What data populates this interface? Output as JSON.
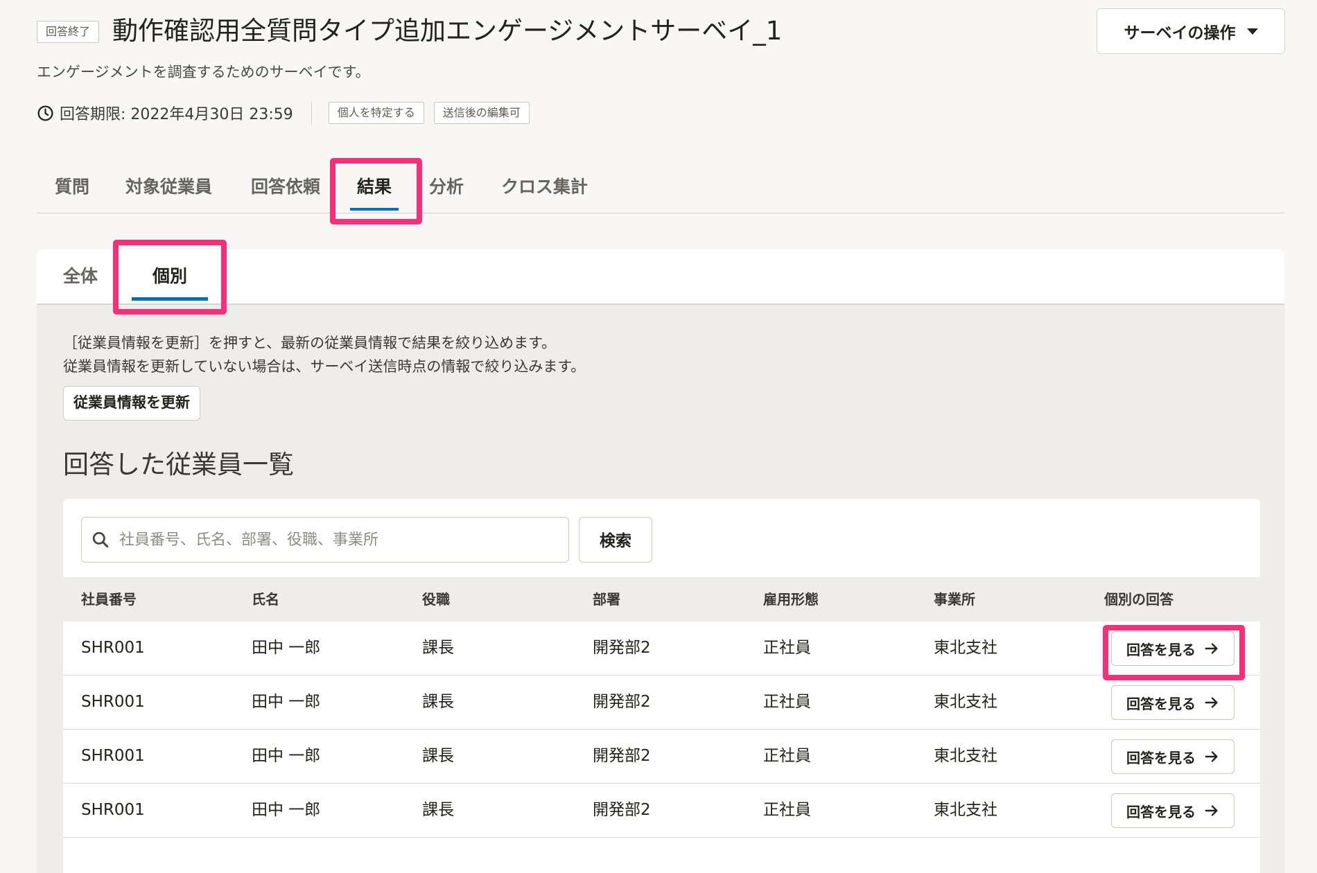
{
  "header": {
    "status": "回答終了",
    "title": "動作確認用全質問タイプ追加エンゲージメントサーベイ_1",
    "description": "エンゲージメントを調査するためのサーベイです。",
    "deadline": "回答期限: 2022年4月30日 23:59",
    "tags": [
      "個人を特定する",
      "送信後の編集可"
    ],
    "ops_button": "サーベイの操作"
  },
  "tabs": {
    "items": [
      "質問",
      "対象従業員",
      "回答依頼",
      "結果",
      "分析",
      "クロス集計"
    ],
    "active": "結果"
  },
  "sub_tabs": {
    "items": [
      "全体",
      "個別"
    ],
    "active": "個別"
  },
  "notice": {
    "line1": "［従業員情報を更新］を押すと、最新の従業員情報で結果を絞り込めます。",
    "line2": "従業員情報を更新していない場合は、サーベイ送信時点の情報で絞り込みます。"
  },
  "refresh_button": "従業員情報を更新",
  "list_title": "回答した従業員一覧",
  "search": {
    "placeholder": "社員番号、氏名、部署、役職、事業所",
    "button": "検索"
  },
  "table": {
    "columns": [
      "社員番号",
      "氏名",
      "役職",
      "部署",
      "雇用形態",
      "事業所",
      "個別の回答"
    ],
    "rows": [
      [
        "SHR001",
        "田中 一郎",
        "課長",
        "開発部2",
        "正社員",
        "東北支社"
      ],
      [
        "SHR001",
        "田中 一郎",
        "課長",
        "開発部2",
        "正社員",
        "東北支社"
      ],
      [
        "SHR001",
        "田中 一郎",
        "課長",
        "開発部2",
        "正社員",
        "東北支社"
      ],
      [
        "SHR001",
        "田中 一郎",
        "課長",
        "開発部2",
        "正社員",
        "東北支社"
      ]
    ],
    "view_button": "回答を見る"
  },
  "colors": {
    "accent": "#0071c1",
    "highlight": "#f2317a",
    "background": "#f8f7f6"
  }
}
